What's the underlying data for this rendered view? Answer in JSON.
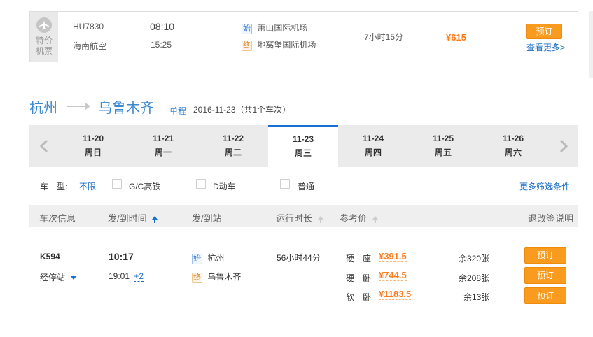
{
  "flight": {
    "promo_label_line1": "特价",
    "promo_label_line2": "机票",
    "flight_no": "HU7830",
    "airline": "海南航空",
    "depart_time": "08:10",
    "arrive_time": "15:25",
    "depart_badge": "始",
    "arrive_badge": "终",
    "depart_airport": "萧山国际机场",
    "arrive_airport": "地窝堡国际机场",
    "duration": "7小时15分",
    "price": "¥615",
    "book_label": "预订",
    "more_label": "查看更多>"
  },
  "route": {
    "from": "杭州",
    "to": "乌鲁木齐",
    "trip_type": "单程",
    "summary": "2016-11-23（共1个车次）"
  },
  "dates": [
    {
      "date": "11-20",
      "weekday": "周日",
      "active": false
    },
    {
      "date": "11-21",
      "weekday": "周一",
      "active": false
    },
    {
      "date": "11-22",
      "weekday": "周二",
      "active": false
    },
    {
      "date": "11-23",
      "weekday": "周三",
      "active": true
    },
    {
      "date": "11-24",
      "weekday": "周四",
      "active": false
    },
    {
      "date": "11-25",
      "weekday": "周五",
      "active": false
    },
    {
      "date": "11-26",
      "weekday": "周六",
      "active": false
    }
  ],
  "filters": {
    "type_label": "车　型:",
    "unlimited": "不限",
    "options": [
      "G/C高铁",
      "D动车",
      "普通"
    ],
    "more_filters": "更多筛选条件"
  },
  "table_header": {
    "col_train": "车次信息",
    "col_time": "发/到时间",
    "col_station": "发/到站",
    "col_duration": "运行时长",
    "col_price": "参考价",
    "refund_note": "退改签说明"
  },
  "train": {
    "number": "K594",
    "stops_label": "经停站",
    "depart_time": "10:17",
    "arrive_time": "19:01",
    "day_offset": "+2",
    "depart_badge": "始",
    "arrive_badge": "终",
    "depart_station": "杭州",
    "arrive_station": "乌鲁木齐",
    "duration": "56小时44分",
    "seats": [
      {
        "type": "硬　座",
        "price": "¥391.5",
        "remaining": "余320张",
        "book": "预订"
      },
      {
        "type": "硬　卧",
        "price": "¥744.5",
        "remaining": "余208张",
        "book": "预订"
      },
      {
        "type": "软　卧",
        "price": "¥1183.5",
        "remaining": "余13张",
        "book": "预订"
      }
    ]
  },
  "colors": {
    "accent_blue": "#3b87d0",
    "price_orange": "#ff7b1b",
    "button_orange": "#f89b1e",
    "active_tab_border": "#1a6fd4"
  }
}
